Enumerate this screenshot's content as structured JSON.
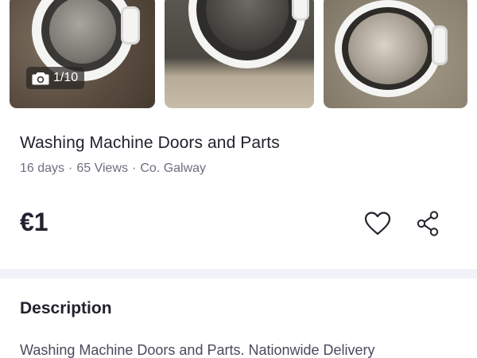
{
  "gallery": {
    "counter": "1/10",
    "icons": {
      "counter": "camera-icon"
    }
  },
  "listing": {
    "title": "Washing Machine Doors and Parts",
    "meta": {
      "age": "16 days",
      "views": "65 Views",
      "location": "Co. Galway",
      "separator": "·"
    },
    "price": "€1",
    "actions": {
      "favourite_icon": "heart-icon",
      "share_icon": "share-icon"
    }
  },
  "description": {
    "heading": "Description",
    "text": "Washing Machine Doors and Parts. Nationwide Delivery"
  },
  "colors": {
    "text_primary": "#22222e",
    "text_secondary": "#6e6e80",
    "divider": "#f1f2f7"
  }
}
